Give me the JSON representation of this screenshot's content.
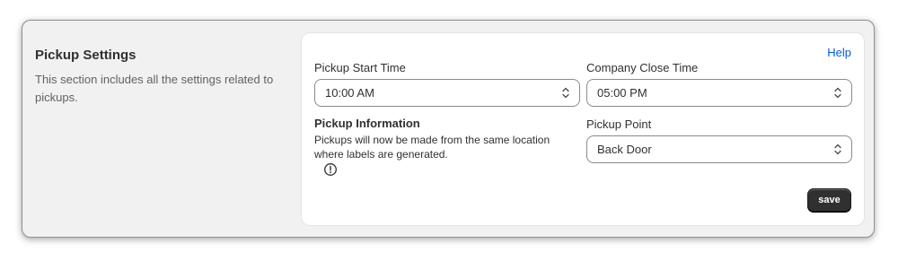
{
  "section": {
    "title": "Pickup Settings",
    "description": "This section includes all the settings related to pickups."
  },
  "card": {
    "help_label": "Help",
    "pickup_start_time": {
      "label": "Pickup Start Time",
      "value": "10:00 AM"
    },
    "company_close_time": {
      "label": "Company Close Time",
      "value": "05:00 PM"
    },
    "pickup_information": {
      "title": "Pickup Information",
      "text": "Pickups will now be made from the same location where labels are generated.",
      "icon": "info-icon"
    },
    "pickup_point": {
      "label": "Pickup Point",
      "value": "Back Door"
    },
    "save_label": "save"
  },
  "colors": {
    "background": "#f1f1f1",
    "card": "#ffffff",
    "link": "#005bd3",
    "button": "#303030"
  }
}
